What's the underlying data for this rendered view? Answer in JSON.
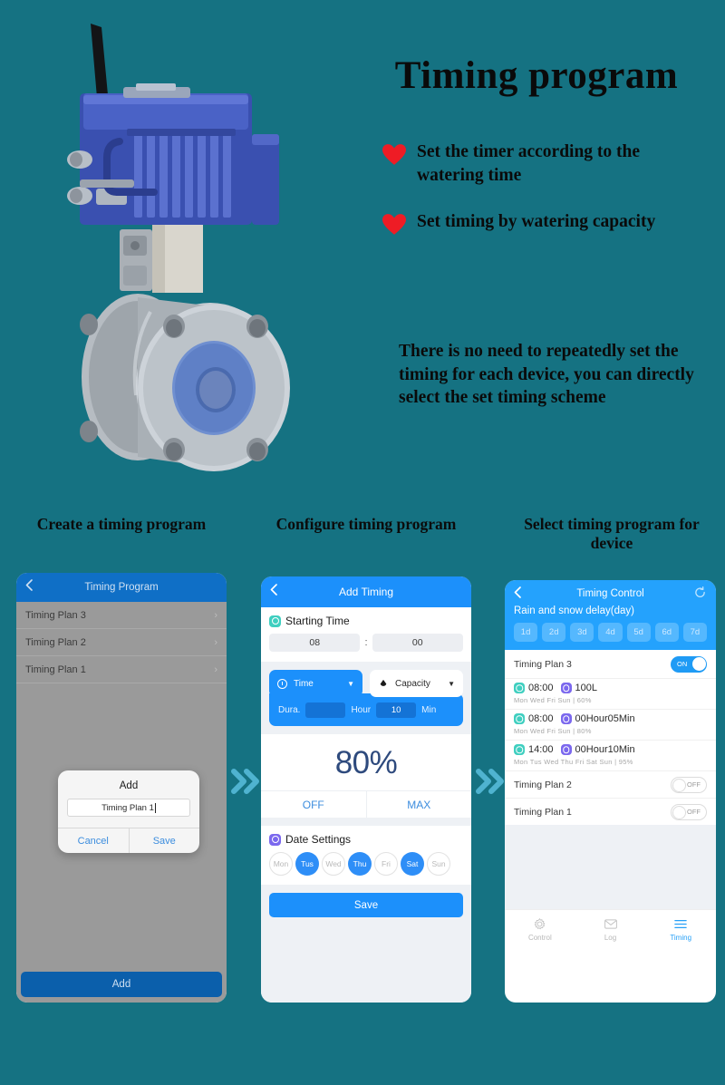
{
  "hero": {
    "title": "Timing program",
    "bullets": [
      "Set the timer according to the watering time",
      "Set timing by watering capacity"
    ],
    "note": "There is no need to repeatedly set the timing for each device, you can directly select the set timing scheme",
    "product_alt": "electric actuated flanged ball valve with antenna"
  },
  "colors": {
    "background": "#157282",
    "heart": "#ee1c25",
    "arrow": "#4fb3d0",
    "accent_blue": "#1c90fb",
    "accent_cyan": "#27a0f7",
    "teal_icon": "#3fcfc0",
    "purple_icon": "#7b68ee"
  },
  "steps": [
    {
      "heading": "Create a timing program"
    },
    {
      "heading": "Configure timing program"
    },
    {
      "heading": "Select timing program for device"
    }
  ],
  "phone1": {
    "header": {
      "title": "Timing Program",
      "back_icon": "chevron-left-icon"
    },
    "list": [
      {
        "label": "Timing Plan 3",
        "chevron": "›"
      },
      {
        "label": "Timing Plan 2",
        "chevron": "›"
      },
      {
        "label": "Timing Plan 1",
        "chevron": "›"
      }
    ],
    "dialog": {
      "title": "Add",
      "input_value": "Timing Plan 1",
      "input_placeholder": "Timing Plan 1",
      "cancel_label": "Cancel",
      "save_label": "Save"
    },
    "add_button": "Add"
  },
  "phone2": {
    "header": {
      "title": "Add Timing",
      "back_icon": "chevron-left-icon"
    },
    "starting_time": {
      "label": "Starting Time",
      "icon": "clock-square-icon",
      "hour": "08",
      "minute": "00",
      "separator": ":"
    },
    "mode_tabs": [
      {
        "label": "Time",
        "icon": "clock-icon",
        "active": true,
        "caret": "▼"
      },
      {
        "label": "Capacity",
        "icon": "water-drop-icon",
        "active": false,
        "caret": "▼"
      }
    ],
    "duration": {
      "label": "Dura.",
      "hour_value": "",
      "hour_unit": "Hour",
      "min_value": "10",
      "min_unit": "Min"
    },
    "percent": {
      "value": "80%",
      "off_label": "OFF",
      "max_label": "MAX"
    },
    "date_settings": {
      "label": "Date Settings",
      "icon": "calendar-icon",
      "days": [
        {
          "label": "Mon",
          "selected": false
        },
        {
          "label": "Tus",
          "selected": true
        },
        {
          "label": "Wed",
          "selected": false
        },
        {
          "label": "Thu",
          "selected": true
        },
        {
          "label": "Fri",
          "selected": false
        },
        {
          "label": "Sat",
          "selected": true
        },
        {
          "label": "Sun",
          "selected": false
        }
      ]
    },
    "save_button": "Save"
  },
  "phone3": {
    "header": {
      "title": "Timing Control",
      "back_icon": "chevron-left-icon",
      "refresh_icon": "refresh-icon",
      "delay_label": "Rain and snow delay(day)",
      "delay_chips": [
        "1d",
        "2d",
        "3d",
        "4d",
        "5d",
        "6d",
        "7d"
      ]
    },
    "plans": [
      {
        "name": "Timing Plan 3",
        "toggle": "ON",
        "toggle_on": true,
        "schedules": [
          {
            "time": "08:00",
            "amount": "100L",
            "days": "Mon  Wed  Fri  Sun",
            "divider": "|",
            "percent": "60%"
          },
          {
            "time": "08:00",
            "amount": "00Hour05Min",
            "days": "Mon  Wed  Fri  Sun",
            "divider": "|",
            "percent": "80%"
          },
          {
            "time": "14:00",
            "amount": "00Hour10Min",
            "days": "Mon  Tus  Wed  Thu  Fri  Sat  Sun",
            "divider": "|",
            "percent": "95%"
          }
        ]
      },
      {
        "name": "Timing Plan 2",
        "toggle": "OFF",
        "toggle_on": false,
        "schedules": []
      },
      {
        "name": "Timing Plan 1",
        "toggle": "OFF",
        "toggle_on": false,
        "schedules": []
      }
    ],
    "nav": [
      {
        "label": "Control",
        "icon": "gear-icon",
        "active": false
      },
      {
        "label": "Log",
        "icon": "mail-icon",
        "active": false
      },
      {
        "label": "Timing",
        "icon": "list-icon",
        "active": true
      }
    ]
  }
}
